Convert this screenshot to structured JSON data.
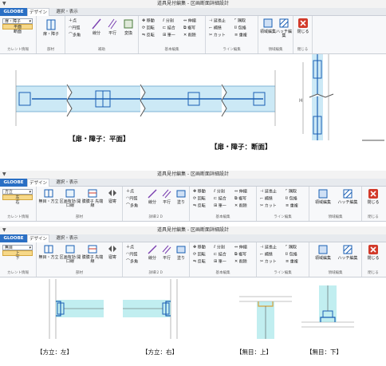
{
  "window": {
    "title": "道具見付編集 - 区画断面詳細設計",
    "qat": "▼"
  },
  "tabs": {
    "app": "GLOOBE",
    "design": "デザイン",
    "select_view": "選択・表示"
  },
  "ribbon1": {
    "current": {
      "value": "扉・障子",
      "options": [
        "平面",
        "断面"
      ],
      "selected": "平面",
      "group": "カレント情報"
    },
    "part": {
      "button": "扉・障子",
      "group": "部材"
    },
    "aux": {
      "point": "点",
      "circle": "円弧",
      "polygon": "多角",
      "line": "線分",
      "parallel": "平行",
      "convert": "変換",
      "group": "補助"
    },
    "basic": {
      "move": "移動",
      "rotate": "回転",
      "mirror": "反転",
      "divide": "分割",
      "join": "結合",
      "collect": "筆一",
      "stretch": "伸縮",
      "copy": "複写",
      "delete": "削除",
      "group": "基本編集"
    },
    "line": {
      "extend": "延長止",
      "connect": "補繕",
      "cut": "カット",
      "corner": "隅取",
      "wrap": "包絡",
      "overlap": "重複",
      "group": "ライン編集"
    },
    "area": {
      "region": "領域編集",
      "hatch": "ハッチ編集",
      "group": "領域編集"
    },
    "close": {
      "label": "閉じる",
      "group": "閉じる"
    }
  },
  "ribbon2": {
    "current": {
      "value": "方立",
      "options": [
        "左",
        "右"
      ],
      "selected": "左",
      "group": "カレント情報"
    },
    "part": {
      "b1": "無目・方立",
      "b2": "区画有効 開口線",
      "b3": "膜膜子 先端線",
      "b4": "寝寄",
      "group": "部材"
    },
    "detail": {
      "point": "点",
      "circle": "円弧",
      "polygon": "多角",
      "line": "線分",
      "parallel": "平行",
      "fill": "塗り",
      "group": "詳細２Ｄ"
    },
    "basic": {
      "move": "移動",
      "rotate": "回転",
      "mirror": "反転",
      "divide": "分割",
      "join": "結合",
      "collect": "筆一",
      "stretch": "伸縮",
      "copy": "複写",
      "delete": "削除",
      "group": "基本編集"
    },
    "line": {
      "extend": "延長止",
      "connect": "補繕",
      "cut": "カット",
      "corner": "隅取",
      "wrap": "包絡",
      "overlap": "重複",
      "group": "ライン編集"
    },
    "area": {
      "region": "領域編集",
      "hatch": "ハッチ編集",
      "group": "領域編集"
    },
    "close": {
      "label": "閉じる",
      "group": "閉じる"
    }
  },
  "ribbon3": {
    "current": {
      "value": "無目",
      "options": [
        "上",
        "下"
      ],
      "selected": "上",
      "group": "カレント情報"
    }
  },
  "captions": {
    "plan": "【扉・障子：平面】",
    "section": "【扉・障子：断面】",
    "mullion_left": "【方立：左】",
    "mullion_right": "【方立：右】",
    "transom_top": "【無目：上】",
    "transom_bottom": "【無目：下】"
  },
  "drawing": {
    "dim_label": "H"
  },
  "colors": {
    "app_tab": "#2a6fc4",
    "selected": "#f6d889",
    "fill": "#cce9f6",
    "line": "#1a5fb4",
    "teal": "#8ee0e4"
  }
}
